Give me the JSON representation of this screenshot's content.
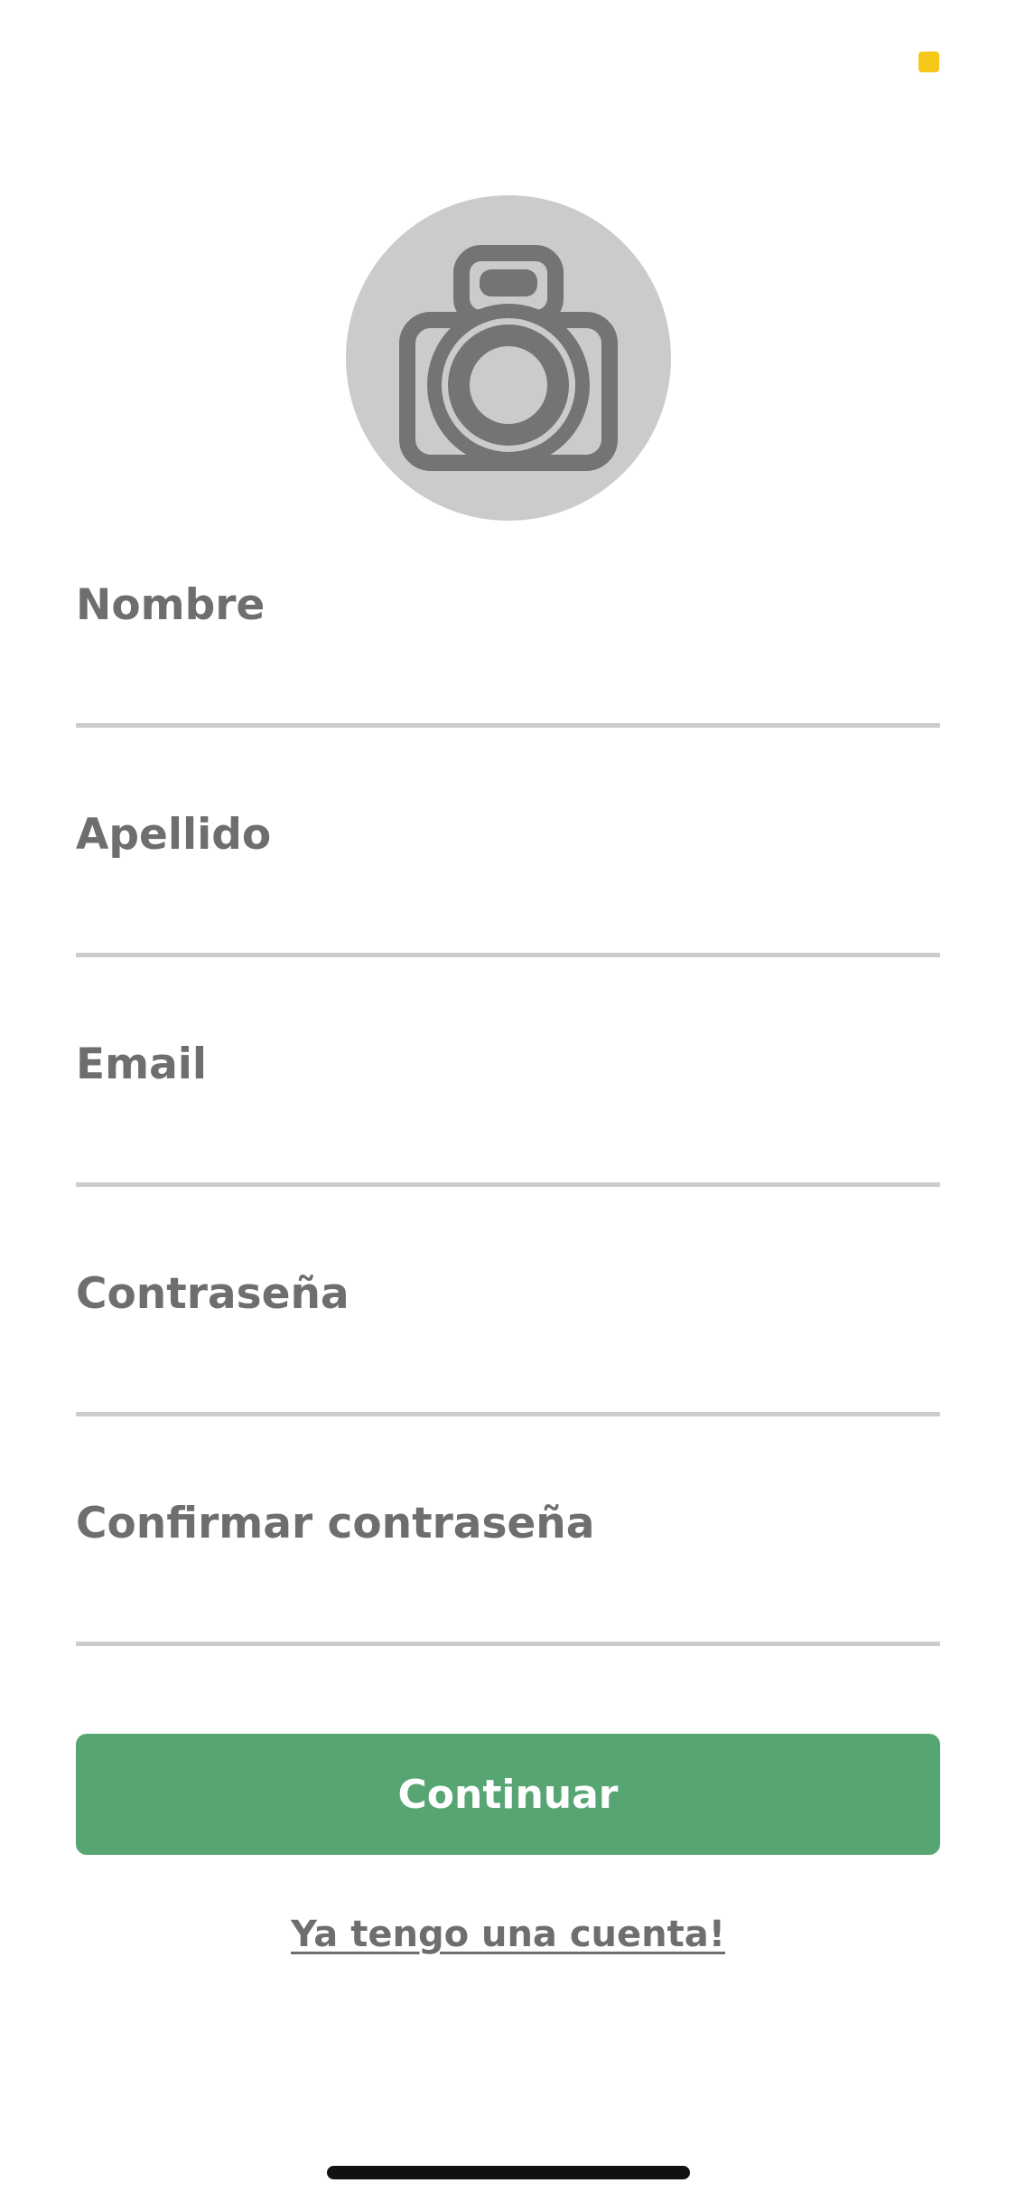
{
  "status": {
    "indicator_color": "#f5c81a"
  },
  "avatar": {
    "icon": "camera-icon",
    "background_color": "#cbcbcb",
    "icon_color": "#747474"
  },
  "form": {
    "fields": [
      {
        "label": "Nombre",
        "value": ""
      },
      {
        "label": "Apellido",
        "value": ""
      },
      {
        "label": "Email",
        "value": ""
      },
      {
        "label": "Contraseña",
        "value": ""
      },
      {
        "label": "Confirmar contraseña",
        "value": ""
      }
    ],
    "label_color": "#6e6e6e",
    "underline_color": "#cccccc"
  },
  "actions": {
    "continue_label": "Continuar",
    "continue_color": "#56a573",
    "login_link": "Ya tengo una cuenta!"
  }
}
